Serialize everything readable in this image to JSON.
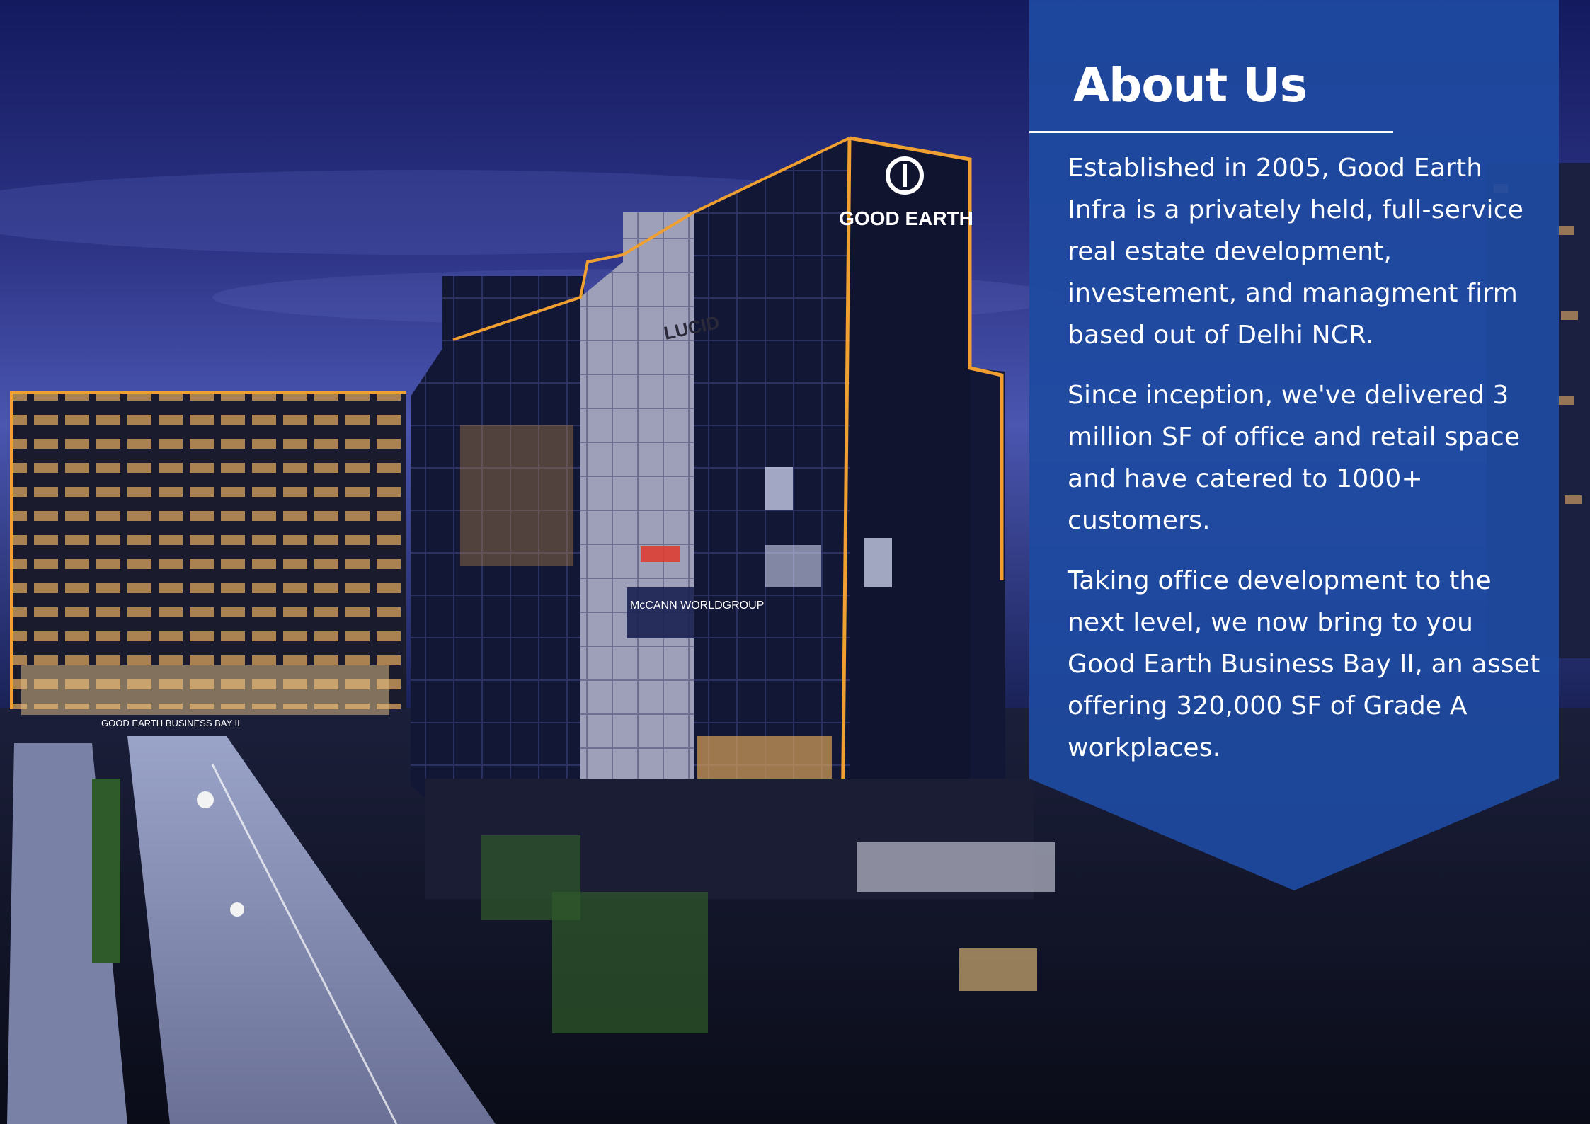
{
  "about": {
    "title": "About Us",
    "paragraphs": [
      "Established in 2005, Good Earth Infra is a privately held, full-service real estate development, investement, and managment firm based out of Delhi NCR.",
      "Since inception, we've delivered 3 million SF of office and retail space and have catered to 1000+ customers.",
      "Taking office development to the next level, we now bring to you Good Earth Business Bay II, an asset offering 320,000 SF of Grade A workplaces."
    ]
  },
  "photo": {
    "building_signs": [
      "GOOD EARTH",
      "LUCID",
      "McCANN WORLDGROUP",
      "GOOD EARTH BUSINESS BAY II"
    ]
  },
  "colors": {
    "panel": "#1e4aa0",
    "sky_top": "#141a5e",
    "sky_bottom": "#4a56b0",
    "building_edge_light": "#f0a030",
    "text": "#ffffff"
  }
}
